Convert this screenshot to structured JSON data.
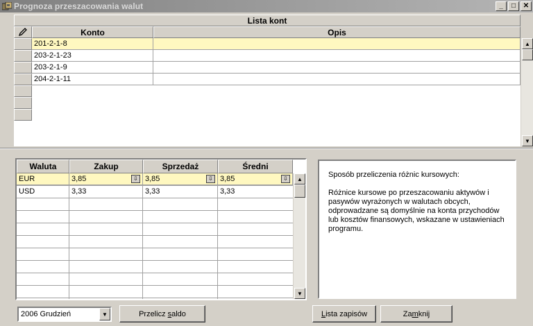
{
  "window": {
    "title": "Prognoza przeszacowania walut",
    "min_label": "_",
    "max_label": "□",
    "close_label": "✕"
  },
  "accounts": {
    "caption": "Lista kont",
    "columns": [
      "Konto",
      "Opis"
    ],
    "rows": [
      {
        "konto": "201-2-1-8",
        "opis": ""
      },
      {
        "konto": "203-2-1-23",
        "opis": ""
      },
      {
        "konto": "203-2-1-9",
        "opis": ""
      },
      {
        "konto": "204-2-1-11",
        "opis": ""
      }
    ],
    "selected_row": 0
  },
  "currencies": {
    "columns": [
      "Waluta",
      "Zakup",
      "Sprzedaż",
      "Średni"
    ],
    "rows": [
      {
        "waluta": "EUR",
        "zakup": "3,85",
        "sprzedaz": "3,85",
        "sredni": "3,85"
      },
      {
        "waluta": "USD",
        "zakup": "3,33",
        "sprzedaz": "3,33",
        "sredni": "3,33"
      }
    ],
    "selected_row": 0
  },
  "info": {
    "heading": "Sposób przeliczenia różnic kursowych:",
    "body": "Różnice kursowe po przeszacowaniu aktywów i pasywów wyrażonych w walutach obcych, odprowadzane są domyślnie na konta przychodów lub kosztów finansowych, wskazane w ustawieniach programu."
  },
  "period_select": {
    "value": "2006 Grudzień"
  },
  "buttons": {
    "recalc_pre": "Przelicz ",
    "recalc_u": "s",
    "recalc_post": "aldo",
    "list_u": "L",
    "list_post": "ista zapisów",
    "close_pre": "Za",
    "close_u": "m",
    "close_post": "knij"
  },
  "colors": {
    "selected_row": "#fff8c0",
    "face": "#d4d0c8",
    "title_gradient_start": "#808080"
  }
}
